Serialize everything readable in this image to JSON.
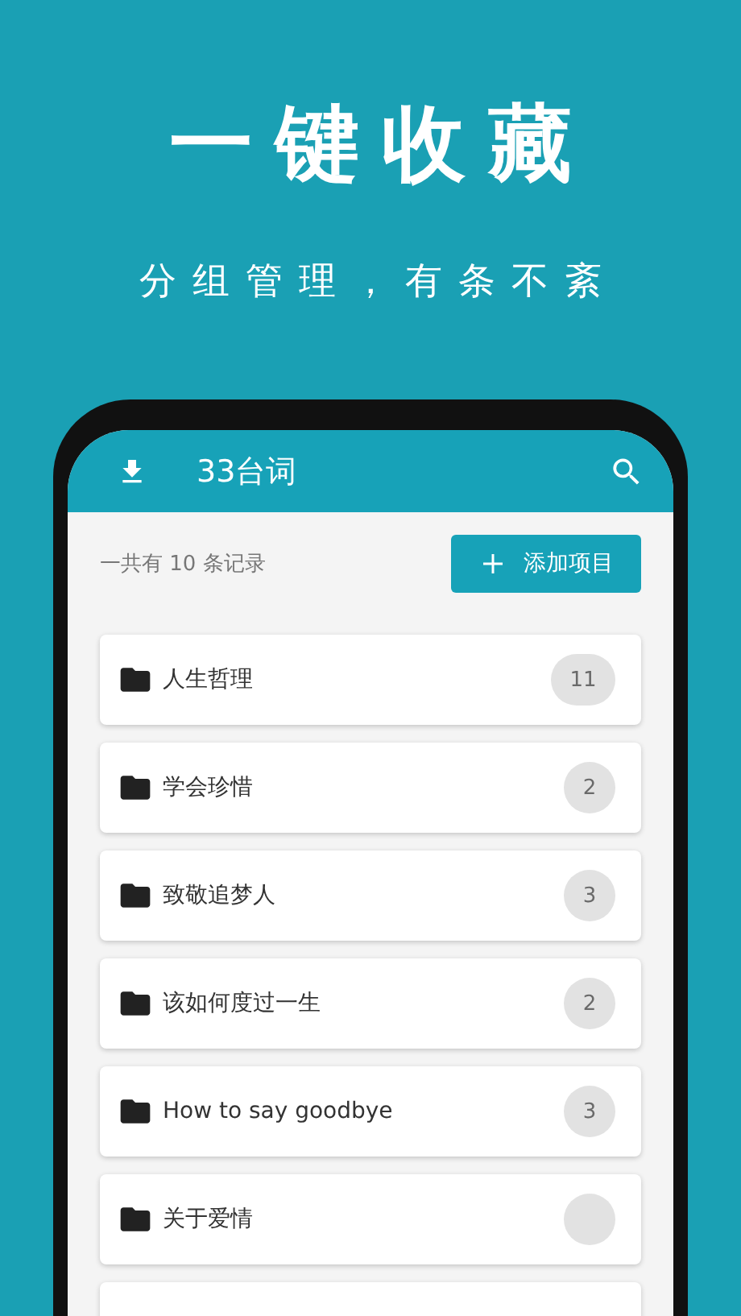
{
  "headline": "一键收藏",
  "subtitle": "分组管理，有条不紊",
  "app_bar": {
    "title": "33台词"
  },
  "summary": "一共有 10 条记录",
  "add_button": {
    "label": "添加项目"
  },
  "groups": [
    {
      "name": "人生哲理",
      "count": "11"
    },
    {
      "name": "学会珍惜",
      "count": "2"
    },
    {
      "name": "致敬追梦人",
      "count": "3"
    },
    {
      "name": "该如何度过一生",
      "count": "2"
    },
    {
      "name": "How to say goodbye",
      "count": "3"
    },
    {
      "name": "关于爱情"
    },
    {
      "kind": "partial"
    }
  ]
}
